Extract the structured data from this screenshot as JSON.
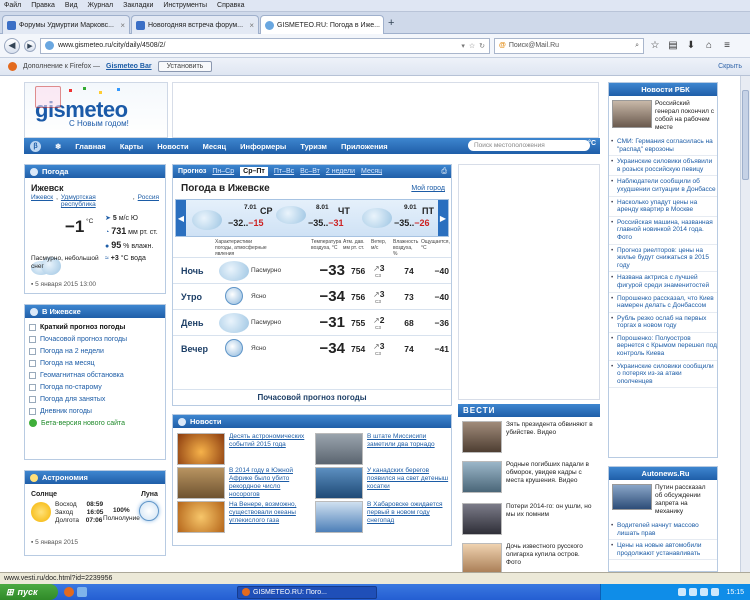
{
  "menubar": [
    "Файл",
    "Правка",
    "Вид",
    "Журнал",
    "Закладки",
    "Инструменты",
    "Справка"
  ],
  "tabs": [
    {
      "title": "Форумы Удмуртии Марковс..."
    },
    {
      "title": "Новогодняя встреча форум..."
    },
    {
      "title": "GISMETEO.RU: Погода в Иже..."
    }
  ],
  "new_tab": "+",
  "nav": {
    "url": "www.gismeteo.ru/city/daily/4508/2/",
    "search_placeholder": "Поиск@Mail.Ru"
  },
  "addon_bar": {
    "text": "Дополнение к Firefox — ",
    "name": "Gismeteo Bar",
    "install": "Установить",
    "hide": "Скрыть"
  },
  "logo": {
    "text": "gismeteo",
    "slogan": "С Новым годом!"
  },
  "site_nav": {
    "items": [
      "Главная",
      "Карты",
      "Новости",
      "Месяц",
      "Информеры",
      "Туризм",
      "Приложения"
    ],
    "search_placeholder": "Поиск местоположения",
    "unit": "°C"
  },
  "weather_now": {
    "title": "Погода",
    "city": "Ижевск",
    "breadcrumb": [
      "Ижевск",
      "Удмуртская республика",
      "Россия"
    ],
    "temp": "−1",
    "temp_unit": "°C",
    "wind": "5",
    "wind_unit": "м/с",
    "wind_dir": "Ю",
    "pressure": "731",
    "pressure_unit": "мм рт. ст.",
    "humidity": "95",
    "humidity_unit": "% влажн.",
    "water": "+3",
    "water_unit": "°C вода",
    "description": "Пасмурно, небольшой снег",
    "date": "5 января 2015 13:00"
  },
  "izhevsk_links": {
    "title": "В Ижевске",
    "items": [
      "Краткий прогноз погоды",
      "Почасовой прогноз погоды",
      "Погода на 2 недели",
      "Погода на месяц",
      "Геомагнитная обстановка",
      "Погода по-старому",
      "Погода для занятых",
      "Дневник погоды"
    ],
    "beta": "Бета-версия нового сайта"
  },
  "astronomy": {
    "title": "Астрономия",
    "sun": "Солнце",
    "moon": "Луна",
    "rows": [
      {
        "label": "Восход",
        "value": "08:59"
      },
      {
        "label": "Заход",
        "value": "16:05"
      },
      {
        "label": "Долгота",
        "value": "07:06"
      }
    ],
    "phase_value": "100%",
    "phase_label": "Полнолуние",
    "date": "5 января 2015"
  },
  "forecast": {
    "tabs": [
      "Прогноз",
      "Пн–Ср",
      "Ср–Пт",
      "Пт–Вс",
      "Вс–Вт",
      "2 недели",
      "Месяц"
    ],
    "selected": "Ср–Пт",
    "title": "Погода в Ижевске",
    "my_city": "Мой город",
    "days": [
      {
        "date": "7.01",
        "dow": "СР",
        "tmin": "−32..",
        "tmax": "−15"
      },
      {
        "date": "8.01",
        "dow": "ЧТ",
        "tmin": "−35..",
        "tmax": "−31"
      },
      {
        "date": "9.01",
        "dow": "ПТ",
        "tmin": "−35..",
        "tmax": "−26"
      }
    ],
    "col_heads": [
      "Характеристики погоды, атмосферные явления",
      "Температура воздуха, °C",
      "Атм. дав. мм рт. ст.",
      "Ветер, м/с",
      "Влажность воздуха, %",
      "Ощущается, °C"
    ],
    "rows": [
      {
        "part": "Ночь",
        "desc": "Пасмурно",
        "temp": "−33",
        "press": "756",
        "wind": "3",
        "wind_dir": "СЗ",
        "hum": "74",
        "feel": "−40",
        "icon": "cloud"
      },
      {
        "part": "Утро",
        "desc": "Ясно",
        "temp": "−34",
        "press": "756",
        "wind": "3",
        "wind_dir": "СЗ",
        "hum": "73",
        "feel": "−40",
        "icon": "moon"
      },
      {
        "part": "День",
        "desc": "Пасмурно",
        "temp": "−31",
        "press": "755",
        "wind": "2",
        "wind_dir": "СЗ",
        "hum": "68",
        "feel": "−36",
        "icon": "cloud"
      },
      {
        "part": "Вечер",
        "desc": "Ясно",
        "temp": "−34",
        "press": "754",
        "wind": "3",
        "wind_dir": "СЗ",
        "hum": "74",
        "feel": "−41",
        "icon": "moon"
      }
    ],
    "hourly_link": "Почасовой прогноз погоды"
  },
  "news": {
    "title": "Новости",
    "items": [
      {
        "text": "Десять астрономических событий 2015 года",
        "color": "#c96a1e"
      },
      {
        "text": "В штате Миссисипи заметили два торнадо",
        "color": "#6d7a88"
      },
      {
        "text": "В 2014 году в Южной Африке было убито рекордное число носорогов",
        "color": "#8a6a3c"
      },
      {
        "text": "У канадских берегов появился на свет детеныш косатки",
        "color": "#2e5f8f"
      },
      {
        "text": "На Венере, возможно, существовали океаны углекислого газа",
        "color": "#d0801f"
      },
      {
        "text": "В Хабаровске ожидается первый в новом году снегопад",
        "color": "#3a6aa6"
      }
    ]
  },
  "vesti": {
    "title": "ВЕСТИ",
    "items": [
      {
        "text": "Зять президента обвиняют в убийстве. Видео",
        "color": "#7a6656"
      },
      {
        "text": "Родные погибших падали в обморок, увидев кадры с места крушения. Видео",
        "color": "#6b8a9e"
      },
      {
        "text": "Потери 2014-го: он ушли, но мы их помним",
        "color": "#5a5a66"
      },
      {
        "text": "Дочь известного русского олигарха купила остров. Фото",
        "color": "#c9a27a"
      }
    ]
  },
  "rbc": {
    "title": "Новости РБК",
    "lead": "Российский генерал покончил с собой на рабочем месте",
    "items": [
      "СМИ: Германия согласилась на \"распад\" еврозоны",
      "Украинские силовики объявили в розыск российскую певицу",
      "Наблюдатели сообщили об ухудшении ситуации в Донбассе",
      "Насколько упадут цены на аренду квартир в Москве",
      "Российская машина, названная главной новинкой 2014 года. Фото",
      "Прогноз риелторов: цены на жилье будут снижаться в 2015 году",
      "Названа актриса с лучшей фигурой среди знаменитостей",
      "Порошенко рассказал, что Киев намерен делать с Донбассом",
      "Рубль резко ослаб на первых торгах в новом году",
      "Порошенко: Полуостров вернется с Крымом перешел под контроль Киева",
      "Украинские силовики сообщили о потерях из-за атаки ополченцев"
    ]
  },
  "autonews": {
    "title": "Autonews.Ru",
    "lead": "Путин рассказал об обсуждении запрета на механику",
    "items": [
      "Водителей начнут массово лишать прав",
      "Цены на новые автомобили продолжают устанавливать"
    ]
  },
  "statusbar": "www.vesti.ru/doc.html?id=2239956",
  "taskbar": {
    "start": "пуск",
    "window": "GISMETEO.RU: Пого...",
    "clock": "15:15"
  }
}
